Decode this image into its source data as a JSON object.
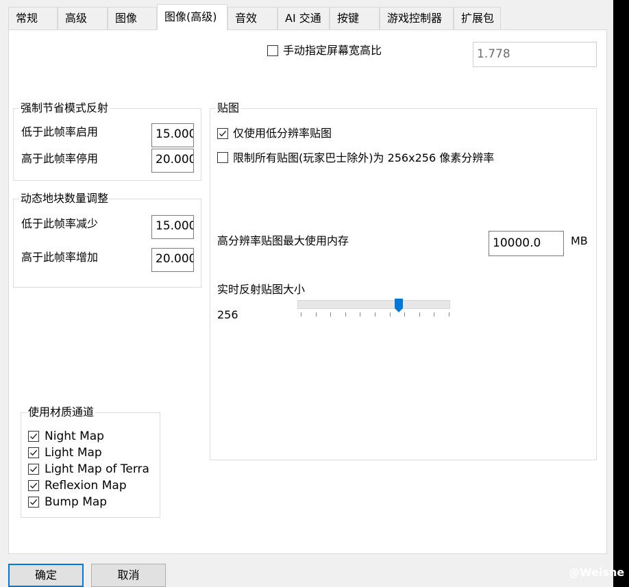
{
  "tabs": [
    {
      "label": "常规"
    },
    {
      "label": "高级"
    },
    {
      "label": "图像"
    },
    {
      "label": "图像(高级)"
    },
    {
      "label": "音效"
    },
    {
      "label": "AI 交通"
    },
    {
      "label": "按键"
    },
    {
      "label": "游戏控制器"
    },
    {
      "label": "扩展包"
    }
  ],
  "active_tab": "图像(高级)",
  "aspect": {
    "checkbox_label": "手动指定屏幕宽高比",
    "checked": false,
    "value": "1.778"
  },
  "power_save_reflection": {
    "title": "强制节省模式反射",
    "enable_below_label": "低于此帧率启用",
    "enable_below_value": "15.000",
    "disable_above_label": "高于此帧率停用",
    "disable_above_value": "20.000"
  },
  "dynamic_tiles": {
    "title": "动态地块数量调整",
    "reduce_below_label": "低于此帧率减少",
    "reduce_below_value": "15.000",
    "increase_above_label": "高于此帧率增加",
    "increase_above_value": "20.000"
  },
  "textures": {
    "title": "贴图",
    "low_res_only_label": "仅使用低分辨率贴图",
    "low_res_only_checked": true,
    "limit_label": "限制所有贴图(玩家巴士除外)为 256x256 像素分辨率",
    "limit_checked": false,
    "max_memory_label": "高分辨率贴图最大使用内存",
    "max_memory_value": "10000.0",
    "max_memory_unit": "MB",
    "reflection_size_label": "实时反射贴图大小",
    "reflection_size_value": "256",
    "reflection_slider_fraction": 0.66
  },
  "material_channels": {
    "title": "使用材质通道",
    "items": [
      {
        "label": "Night Map",
        "checked": true
      },
      {
        "label": "Light Map",
        "checked": true
      },
      {
        "label": "Light Map of Terra",
        "checked": true
      },
      {
        "label": "Reflexion Map",
        "checked": true
      },
      {
        "label": "Bump Map",
        "checked": true
      }
    ]
  },
  "buttons": {
    "ok": "确定",
    "cancel": "取消"
  },
  "watermark": "@Weisne",
  "colors": {
    "accent": "#0078d7",
    "background": "#f0f0f0",
    "panel": "#ffffff"
  }
}
